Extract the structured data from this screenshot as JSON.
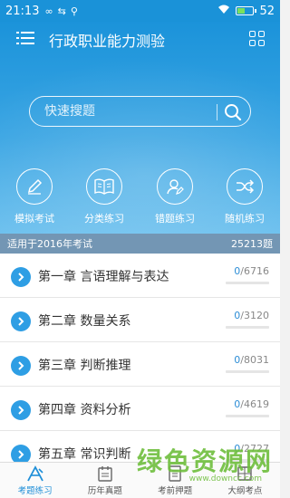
{
  "status_bar": {
    "time": "21:13",
    "battery_percent": "52",
    "battery_level": 0.52
  },
  "header": {
    "title": "行政职业能力测验",
    "menu_icon": "menu-icon",
    "grid_icon": "grid-icon"
  },
  "search": {
    "placeholder": "快速搜题",
    "icon": "search-icon"
  },
  "features": [
    {
      "label": "模拟考试",
      "icon": "pencil-icon"
    },
    {
      "label": "分类练习",
      "icon": "book-icon"
    },
    {
      "label": "错题练习",
      "icon": "user-edit-icon"
    },
    {
      "label": "随机练习",
      "icon": "shuffle-icon"
    }
  ],
  "info_bar": {
    "label": "适用于2016年考试",
    "count": "25213题"
  },
  "chapters": [
    {
      "title": "第一章 言语理解与表达",
      "done": "0",
      "total": "/6716",
      "progress": 0
    },
    {
      "title": "第二章 数量关系",
      "done": "0",
      "total": "/3120",
      "progress": 0
    },
    {
      "title": "第三章 判断推理",
      "done": "0",
      "total": "/8031",
      "progress": 0
    },
    {
      "title": "第四章 资料分析",
      "done": "0",
      "total": "/4619",
      "progress": 0
    },
    {
      "title": "第五章 常识判断",
      "done": "0",
      "total": "/2727",
      "progress": 0
    }
  ],
  "tabs": [
    {
      "label": "考题练习",
      "icon": "practice-icon",
      "active": true
    },
    {
      "label": "历年真题",
      "icon": "calendar-icon",
      "active": false
    },
    {
      "label": "考前押题",
      "icon": "document-icon",
      "active": false
    },
    {
      "label": "大纲考点",
      "icon": "outline-icon",
      "active": false
    }
  ],
  "watermark": {
    "text": "绿色资源网",
    "url": "www.downcc.com"
  },
  "colors": {
    "primary": "#1b93da",
    "info_bar": "#7396b4",
    "accent": "#2e9ee4"
  }
}
